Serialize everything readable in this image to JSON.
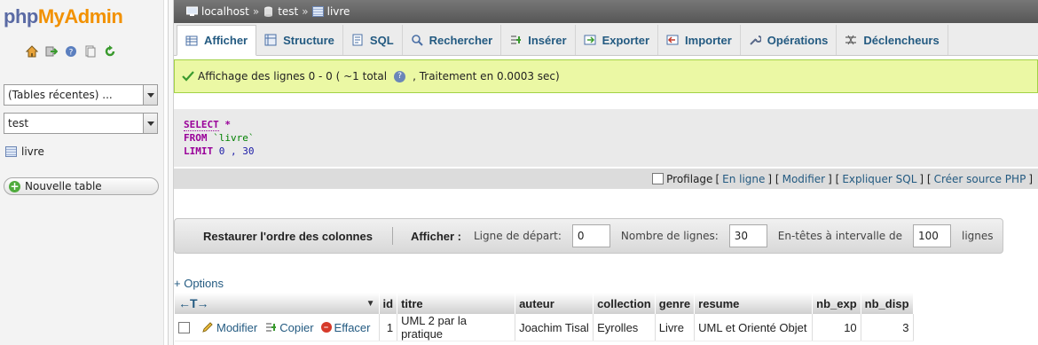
{
  "colors": {
    "accent": "#235a81",
    "logo_php": "#5a6aa4",
    "logo_admin": "#f29100",
    "success_bg": "#ebf8a4"
  },
  "logo": {
    "php": "php",
    "admin": "MyAdmin"
  },
  "left": {
    "nav_icons": [
      "home-icon",
      "exit-icon",
      "help-icon",
      "docs-icon",
      "reload-icon"
    ],
    "recent_tables": "(Tables récentes) ...",
    "database": "test",
    "tables": [
      "livre"
    ],
    "new_table": "Nouvelle table"
  },
  "breadcrumb": {
    "server": "localhost",
    "sep": "»",
    "database": "test",
    "table": "livre"
  },
  "tabs": [
    {
      "label": "Afficher",
      "icon": "browse-icon"
    },
    {
      "label": "Structure",
      "icon": "structure-icon"
    },
    {
      "label": "SQL",
      "icon": "sql-icon"
    },
    {
      "label": "Rechercher",
      "icon": "search-icon"
    },
    {
      "label": "Insérer",
      "icon": "insert-icon"
    },
    {
      "label": "Exporter",
      "icon": "export-icon"
    },
    {
      "label": "Importer",
      "icon": "import-icon"
    },
    {
      "label": "Opérations",
      "icon": "wrench-icon"
    },
    {
      "label": "Déclencheurs",
      "icon": "triggers-icon"
    }
  ],
  "message": {
    "part1": "Affichage des lignes 0 - 0 ( ~1 total",
    "part2": ", Traitement en 0.0003 sec)"
  },
  "sql": {
    "select": "SELECT",
    "star": " *",
    "from": "FROM",
    "table": " `livre`",
    "limit": "LIMIT",
    "limit_values": " 0 , 30"
  },
  "sql_links": {
    "profiling": "Profilage",
    "inline": "En ligne",
    "edit": "Modifier",
    "explain": "Expliquer SQL",
    "php": "Créer source PHP",
    "open": "[",
    "close": "]",
    "mid": "] ["
  },
  "navbar": {
    "restore": "Restaurer l'ordre des colonnes",
    "show": "Afficher :",
    "start_label": "Ligne de départ:",
    "start_value": "0",
    "rows_label": "Nombre de lignes:",
    "rows_value": "30",
    "headers_label": "En-têtes à intervalle de",
    "headers_value": "100",
    "rows_suffix": "lignes"
  },
  "options": "+ Options",
  "table": {
    "arrows": "←T→",
    "columns": [
      "id",
      "titre",
      "auteur",
      "collection",
      "genre",
      "resume",
      "nb_exp",
      "nb_disp"
    ],
    "actions": {
      "edit": "Modifier",
      "copy": "Copier",
      "delete": "Effacer"
    },
    "rows": [
      {
        "id": "1",
        "titre": "UML 2 par la pratique",
        "auteur": "Joachim Tisal",
        "collection": "Eyrolles",
        "genre": "Livre",
        "resume": "UML et Orienté Objet",
        "nb_exp": "10",
        "nb_disp": "3"
      }
    ]
  }
}
